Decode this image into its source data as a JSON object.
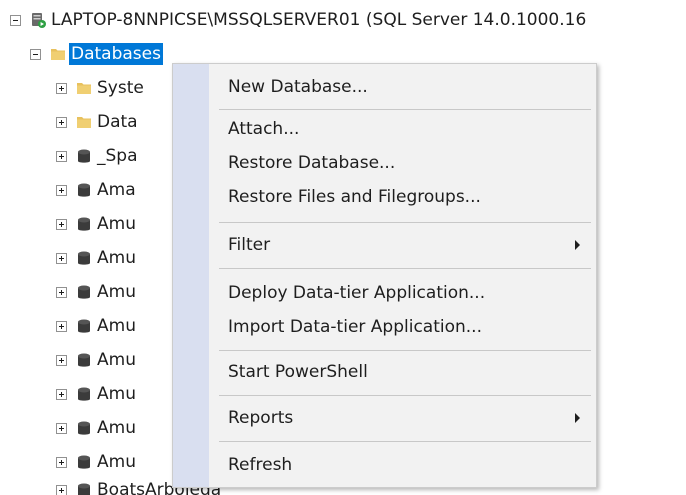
{
  "tree": {
    "server": {
      "label": "LAPTOP-8NNPICSE\\MSSQLSERVER01 (SQL Server 14.0.1000.16",
      "icon": "sql-server-icon"
    },
    "databases": {
      "label": "Databases",
      "icon": "folder-icon",
      "selected": true
    },
    "children": [
      {
        "label": "Syste",
        "icon": "folder-icon"
      },
      {
        "label": "Data",
        "icon": "folder-icon"
      },
      {
        "label": "_Spa",
        "icon": "database-icon"
      },
      {
        "label": "Ama",
        "icon": "database-icon"
      },
      {
        "label": "Amu",
        "icon": "database-icon"
      },
      {
        "label": "Amu",
        "icon": "database-icon"
      },
      {
        "label": "Amu",
        "icon": "database-icon"
      },
      {
        "label": "Amu",
        "icon": "database-icon"
      },
      {
        "label": "Amu",
        "icon": "database-icon"
      },
      {
        "label": "Amu",
        "icon": "database-icon"
      },
      {
        "label": "Amu",
        "icon": "database-icon"
      },
      {
        "label": "Amu",
        "icon": "database-icon"
      },
      {
        "label": "BoatsArboleda",
        "icon": "database-icon"
      }
    ]
  },
  "context_menu": {
    "items": [
      {
        "label": "New Database..."
      },
      {
        "label": "Attach..."
      },
      {
        "label": "Restore Database..."
      },
      {
        "label": "Restore Files and Filegroups..."
      },
      {
        "label": "Filter",
        "has_submenu": true
      },
      {
        "label": "Deploy Data-tier Application..."
      },
      {
        "label": "Import Data-tier Application..."
      },
      {
        "label": "Start PowerShell"
      },
      {
        "label": "Reports",
        "has_submenu": true
      },
      {
        "label": "Refresh"
      }
    ]
  },
  "colors": {
    "selection": "#0078d7",
    "folder": "#e8c15d",
    "database": "#3b3b3b",
    "menu_background": "#f2f2f2",
    "menu_gutter": "#d9dff0"
  }
}
